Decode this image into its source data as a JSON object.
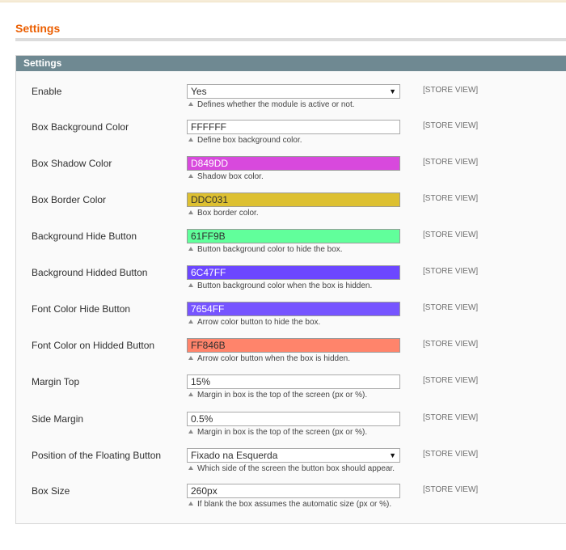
{
  "page": {
    "title": "Settings"
  },
  "fieldset": {
    "title": "Settings"
  },
  "fields": [
    {
      "label": "Enable",
      "type": "select",
      "value": "Yes",
      "note": "Defines whether the module is active or not.",
      "scope": "[STORE VIEW]"
    },
    {
      "label": "Box Background Color",
      "type": "color",
      "value": "FFFFFF",
      "note": "Define box background color.",
      "scope": "[STORE VIEW]",
      "color": "#FFFFFF"
    },
    {
      "label": "Box Shadow Color",
      "type": "color",
      "value": "D849DD",
      "note": "Shadow box color.",
      "scope": "[STORE VIEW]",
      "color": "#D849DD"
    },
    {
      "label": "Box Border Color",
      "type": "color",
      "value": "DDC031",
      "note": "Box border color.",
      "scope": "[STORE VIEW]",
      "color": "#DDC031"
    },
    {
      "label": "Background Hide Button",
      "type": "color",
      "value": "61FF9B",
      "note": "Button background color to hide the box.",
      "scope": "[STORE VIEW]",
      "color": "#61FF9B"
    },
    {
      "label": "Background Hidded Button",
      "type": "color",
      "value": "6C47FF",
      "note": "Button background color when the box is hidden.",
      "scope": "[STORE VIEW]",
      "color": "#6C47FF"
    },
    {
      "label": "Font Color Hide Button",
      "type": "color",
      "value": "7654FF",
      "note": "Arrow color button to hide the box.",
      "scope": "[STORE VIEW]",
      "color": "#7654FF"
    },
    {
      "label": "Font Color on Hidded Button",
      "type": "color",
      "value": "FF846B",
      "note": "Arrow color button when the box is hidden.",
      "scope": "[STORE VIEW]",
      "color": "#FF846B"
    },
    {
      "label": "Margin Top",
      "type": "text",
      "value": "15%",
      "note": "Margin in box is the top of the screen (px or %).",
      "scope": "[STORE VIEW]"
    },
    {
      "label": "Side Margin",
      "type": "text",
      "value": "0.5%",
      "note": "Margin in box is the top of the screen (px or %).",
      "scope": "[STORE VIEW]"
    },
    {
      "label": "Position of the Floating Button",
      "type": "select",
      "value": "Fixado na Esquerda",
      "note": "Which side of the screen the button box should appear.",
      "scope": "[STORE VIEW]"
    },
    {
      "label": "Box Size",
      "type": "text",
      "value": "260px",
      "note": "If blank the box assumes the automatic size (px or %).",
      "scope": "[STORE VIEW]"
    }
  ],
  "icons": {
    "select_arrow": "▼",
    "note_marker": "triangle-up-icon"
  },
  "colors": {
    "title": "#EB5E00",
    "header_bar": "#6F8992"
  }
}
